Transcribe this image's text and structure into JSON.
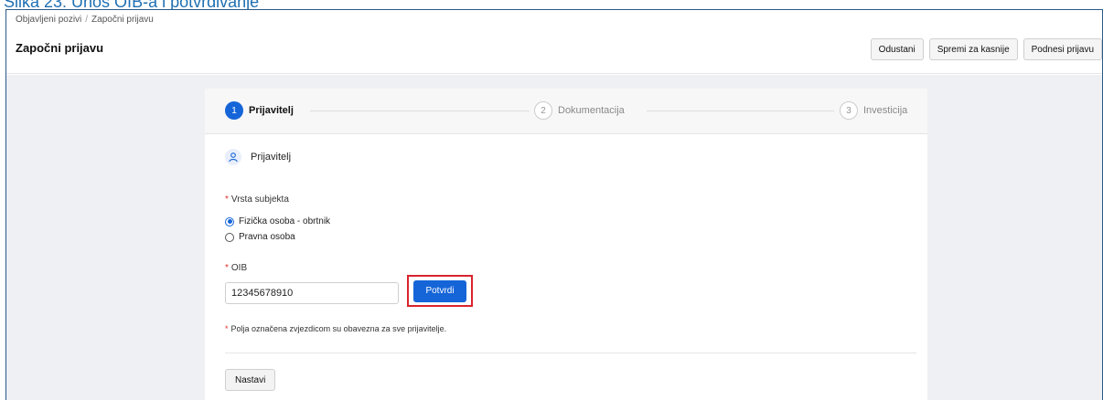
{
  "caption": "Slika 23: Unos OIB-a i potvrđivanje",
  "breadcrumb": {
    "items": [
      "Objavljeni pozivi",
      "Započni prijavu"
    ],
    "separator": "/"
  },
  "header": {
    "title": "Započni prijavu",
    "cancel_label": "Odustani",
    "save_later_label": "Spremi za kasnije",
    "submit_label": "Podnesi prijavu"
  },
  "stepper": {
    "steps": [
      {
        "number": "1",
        "label": "Prijavitelj",
        "state": "active"
      },
      {
        "number": "2",
        "label": "Dokumentacija",
        "state": "inactive"
      },
      {
        "number": "3",
        "label": "Investicija",
        "state": "inactive"
      }
    ]
  },
  "section": {
    "title": "Prijavitelj",
    "icon": "user-icon"
  },
  "subject_type": {
    "label": "Vrsta subjekta",
    "required_mark": "*",
    "options": [
      {
        "label": "Fizička osoba - obrtnik",
        "checked": true
      },
      {
        "label": "Pravna osoba",
        "checked": false
      }
    ]
  },
  "oib": {
    "label": "OIB",
    "required_mark": "*",
    "value": "12345678910",
    "confirm_label": "Potvrdi"
  },
  "note": {
    "required_mark": "*",
    "text": "Polja označena zvjezdicom su obavezna za sve prijavitelje."
  },
  "next_label": "Nastavi",
  "colors": {
    "accent": "#1565d8",
    "highlight": "#d9232d",
    "required": "#e0312c",
    "background": "#eef0f3"
  }
}
